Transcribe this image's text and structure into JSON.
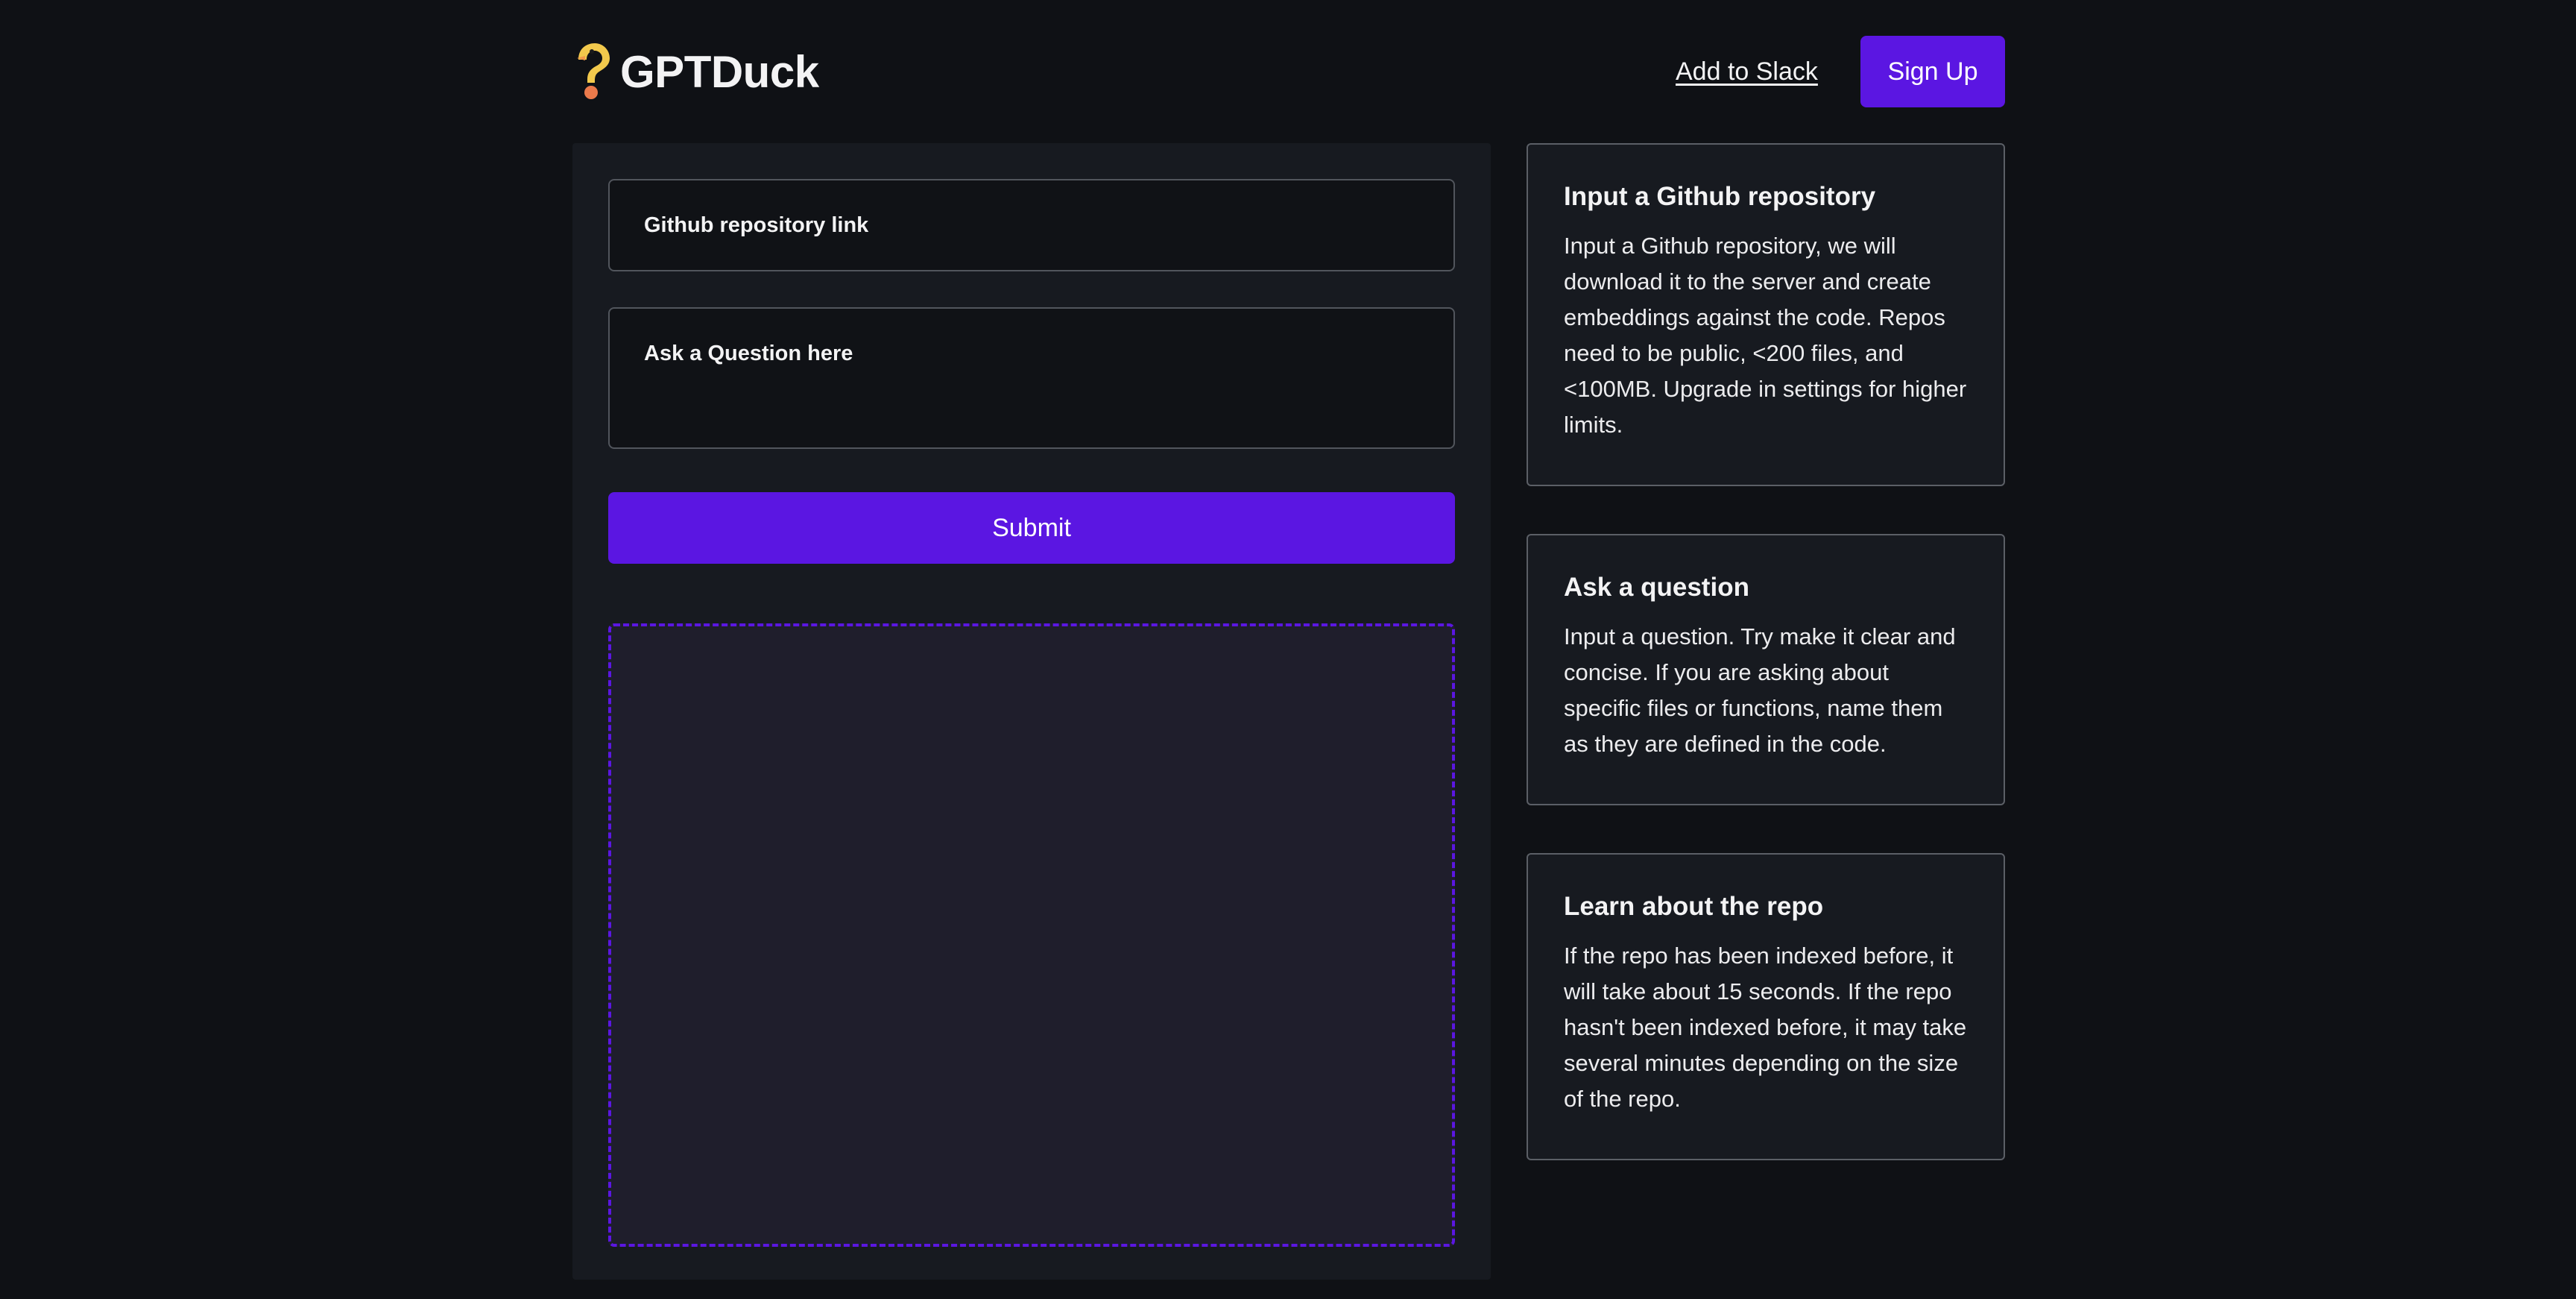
{
  "header": {
    "brand": "GPTDuck",
    "add_to_slack": "Add to Slack",
    "sign_up": "Sign Up"
  },
  "form": {
    "repo_placeholder": "Github repository link",
    "question_placeholder": "Ask a Question here",
    "submit_label": "Submit"
  },
  "cards": [
    {
      "title": "Input a Github repository",
      "body": "Input a Github repository, we will download it to the server and create embeddings against the code. Repos need to be public, <200 files, and <100MB. Upgrade in settings for higher limits."
    },
    {
      "title": "Ask a question",
      "body": "Input a question. Try make it clear and concise. If you are asking about specific files or functions, name them as they are defined in the code."
    },
    {
      "title": "Learn about the repo",
      "body": "If the repo has been indexed before, it will take about 15 seconds. If the repo hasn't been indexed before, it may take several minutes depending on the size of the repo."
    }
  ],
  "theme": {
    "accent": "#5b16e2",
    "background": "#0f1115",
    "panel": "#171a20"
  },
  "icons": {
    "logo": "duck-question-icon"
  }
}
